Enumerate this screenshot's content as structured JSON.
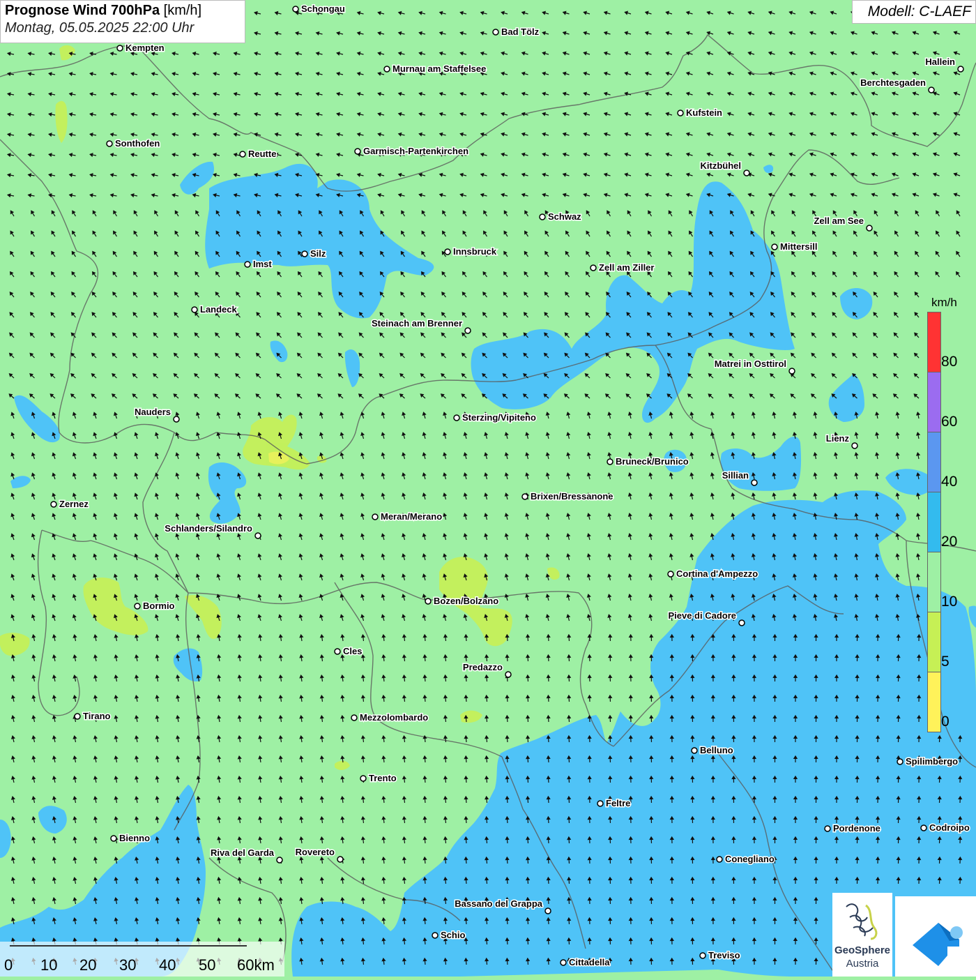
{
  "title": {
    "main": "Prognose Wind 700hPa",
    "unit": "[km/h]",
    "datetime": "Montag, 05.05.2025 22:00 Uhr"
  },
  "model": "Modell: C-LAEF",
  "legend": {
    "unit": "km/h",
    "labels": [
      "80",
      "60",
      "40",
      "20",
      "10",
      "5",
      "0"
    ],
    "colors": [
      "#ff3333",
      "#9b6cf0",
      "#5b97f0",
      "#33bbee",
      "#9ef0a4",
      "#c6f055",
      "#fff25a"
    ]
  },
  "scale_bar": {
    "labels": [
      "0",
      "10",
      "20",
      "30",
      "40",
      "50",
      "60km"
    ]
  },
  "logo": {
    "name_line1": "GeoSphere",
    "name_line2": "Austria"
  },
  "colors": {
    "wind_10_20": "#9ef0a4",
    "wind_20_40": "#4fc3f7",
    "wind_5_10": "#c6f055",
    "border": "#555555"
  },
  "cities": [
    {
      "name": "Schongau"
    },
    {
      "name": "Bad Tölz"
    },
    {
      "name": "Kempten"
    },
    {
      "name": "Murnau am Staffelsee"
    },
    {
      "name": "Hallein"
    },
    {
      "name": "Berchtesgaden"
    },
    {
      "name": "Kufstein"
    },
    {
      "name": "Sonthofen"
    },
    {
      "name": "Reutte"
    },
    {
      "name": "Garmisch-Partenkirchen"
    },
    {
      "name": "Kitzbühel"
    },
    {
      "name": "Schwaz"
    },
    {
      "name": "Zell am See"
    },
    {
      "name": "Mittersill"
    },
    {
      "name": "Silz"
    },
    {
      "name": "Innsbruck"
    },
    {
      "name": "Imst"
    },
    {
      "name": "Zell am Ziller"
    },
    {
      "name": "Landeck"
    },
    {
      "name": "Steinach am Brenner"
    },
    {
      "name": "Matrei in Osttirol"
    },
    {
      "name": "Nauders"
    },
    {
      "name": "Sterzing/Vipiteno"
    },
    {
      "name": "Lienz"
    },
    {
      "name": "Bruneck/Brunico"
    },
    {
      "name": "Sillian"
    },
    {
      "name": "Zernez"
    },
    {
      "name": "Brixen/Bressanone"
    },
    {
      "name": "Meran/Merano"
    },
    {
      "name": "Schlanders/Silandro"
    },
    {
      "name": "Cortina d'Ampezzo"
    },
    {
      "name": "Bozen/Bolzano"
    },
    {
      "name": "Bormio"
    },
    {
      "name": "Pieve di Cadore"
    },
    {
      "name": "Cles"
    },
    {
      "name": "Predazzo"
    },
    {
      "name": "Tirano"
    },
    {
      "name": "Mezzolombardo"
    },
    {
      "name": "Belluno"
    },
    {
      "name": "Spilimbergo"
    },
    {
      "name": "Trento"
    },
    {
      "name": "Feltre"
    },
    {
      "name": "Pordenone"
    },
    {
      "name": "Codroipo"
    },
    {
      "name": "Bienno"
    },
    {
      "name": "Riva del Garda"
    },
    {
      "name": "Rovereto"
    },
    {
      "name": "Conegliano"
    },
    {
      "name": "Bassano del Grappa"
    },
    {
      "name": "Schio"
    },
    {
      "name": "Treviso"
    },
    {
      "name": "Cittadella"
    }
  ]
}
